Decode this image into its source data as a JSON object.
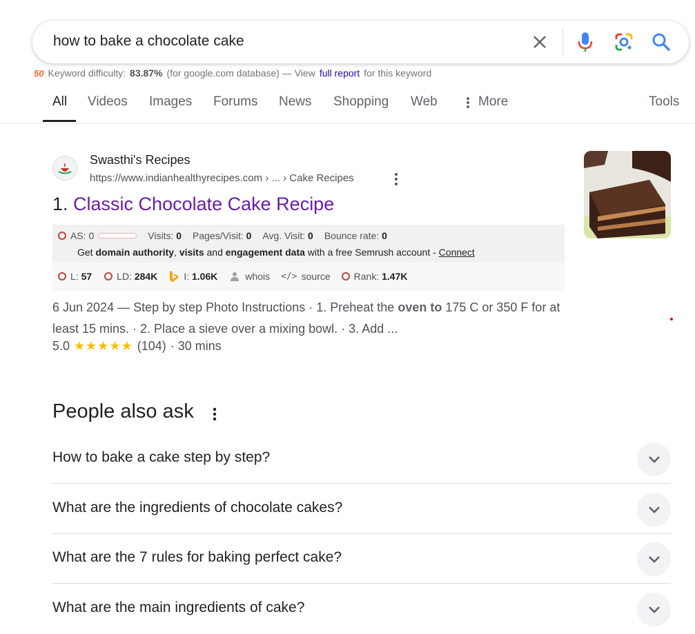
{
  "search": {
    "query": "how to bake a chocolate cake"
  },
  "keyword_difficulty": {
    "logo_text": "50",
    "label": "Keyword difficulty:",
    "value": "83.87%",
    "db_note": "(for google.com database) — View",
    "link_text": "full report",
    "tail": "for this keyword"
  },
  "tabs": [
    {
      "label": "All",
      "active": true
    },
    {
      "label": "Videos"
    },
    {
      "label": "Images"
    },
    {
      "label": "Forums"
    },
    {
      "label": "News"
    },
    {
      "label": "Shopping"
    },
    {
      "label": "Web"
    },
    {
      "label": "More"
    },
    {
      "label": "Tools"
    }
  ],
  "result": {
    "site_name": "Swasthi's Recipes",
    "url": "https://www.indianhealthyrecipes.com › ... › Cake Recipes",
    "number": "1.",
    "title": "Classic Chocolate Cake Recipe",
    "seo": {
      "as_label": "AS:",
      "as_value": "0",
      "visits_label": "Visits:",
      "visits_value": "0",
      "pages_label": "Pages/Visit:",
      "pages_value": "0",
      "avg_label": "Avg. Visit:",
      "avg_value": "0",
      "bounce_label": "Bounce rate:",
      "bounce_value": "0",
      "promo_1": "Get",
      "promo_b1": "domain authority",
      "promo_2": ",",
      "promo_b2": "visits",
      "promo_3": "and",
      "promo_b3": "engagement data",
      "promo_4": "with a free Semrush account -",
      "promo_link": "Connect",
      "l_label": "L:",
      "l_value": "57",
      "ld_label": "LD:",
      "ld_value": "284K",
      "i_label": "I:",
      "i_value": "1.06K",
      "whois": "whois",
      "source": "source",
      "rank_label": "Rank:",
      "rank_value": "1.47K"
    },
    "snippet_1": "6 Jun 2024 — Step by step Photo Instructions · 1. Preheat the",
    "snippet_bold": "oven to",
    "snippet_2": "175 C or 350 F for at least 15 mins. · 2. Place a sieve over a mixing bowl. · 3. Add ...",
    "rating_value": "5.0",
    "stars": "★★★★★",
    "rating_count": "(104)",
    "duration": "· 30 mins",
    "rating_fraction": 1.0
  },
  "people_also_ask": {
    "title": "People also ask",
    "questions": [
      "How to bake a cake step by step?",
      "What are the ingredients of chocolate cakes?",
      "What are the 7 rules for baking perfect cake?",
      "What are the main ingredients of cake?"
    ]
  }
}
